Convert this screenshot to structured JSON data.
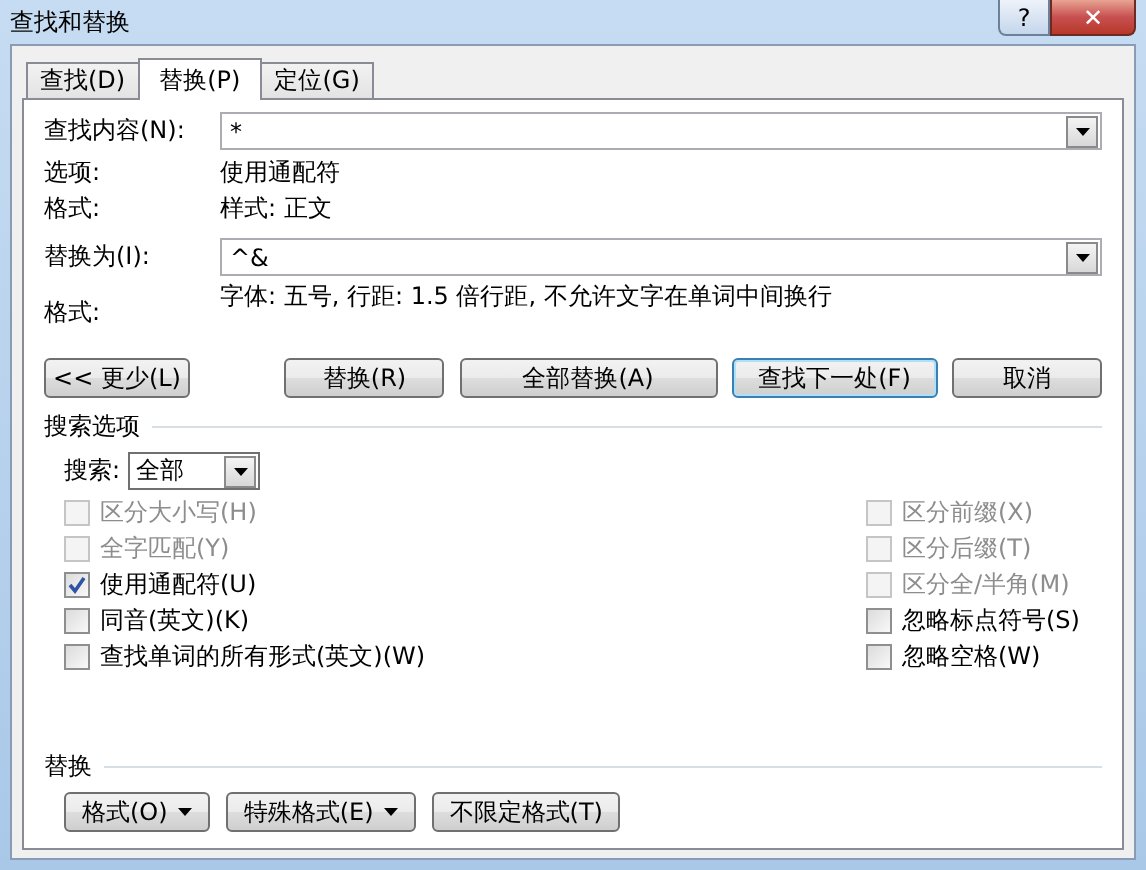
{
  "window": {
    "title": "查找和替换",
    "help_button": "?",
    "close_button": "✕"
  },
  "tabs": [
    {
      "label": "查找(D)",
      "selected": false
    },
    {
      "label": "替换(P)",
      "selected": true
    },
    {
      "label": "定位(G)",
      "selected": false
    }
  ],
  "find": {
    "label": "查找内容(N):",
    "value": "*",
    "options_label": "选项:",
    "options_value": "使用通配符",
    "format_label": "格式:",
    "format_value": "样式: 正文"
  },
  "replace": {
    "label": "替换为(I):",
    "value": "^&",
    "format_label": "格式:",
    "format_value": "字体: 五号, 行距: 1.5 倍行距, 不允许文字在单词中间换行"
  },
  "buttons": [
    {
      "label": "<< 更少(L)",
      "default": false
    },
    {
      "label": "替换(R)",
      "default": false
    },
    {
      "label": "全部替换(A)",
      "default": false
    },
    {
      "label": "查找下一处(F)",
      "default": true
    },
    {
      "label": "取消",
      "default": false
    }
  ],
  "search_options": {
    "title": "搜索选项",
    "search_label": "搜索:",
    "search_value": "全部",
    "left": [
      {
        "label": "区分大小写(H)",
        "checked": false,
        "disabled": true
      },
      {
        "label": "全字匹配(Y)",
        "checked": false,
        "disabled": true
      },
      {
        "label": "使用通配符(U)",
        "checked": true,
        "disabled": false
      },
      {
        "label": "同音(英文)(K)",
        "checked": false,
        "disabled": false
      },
      {
        "label": "查找单词的所有形式(英文)(W)",
        "checked": false,
        "disabled": false
      }
    ],
    "right": [
      {
        "label": "区分前缀(X)",
        "checked": false,
        "disabled": true
      },
      {
        "label": "区分后缀(T)",
        "checked": false,
        "disabled": true
      },
      {
        "label": "区分全/半角(M)",
        "checked": false,
        "disabled": true
      },
      {
        "label": "忽略标点符号(S)",
        "checked": false,
        "disabled": false
      },
      {
        "label": "忽略空格(W)",
        "checked": false,
        "disabled": false
      }
    ]
  },
  "replace_section": {
    "title": "替换",
    "buttons": [
      {
        "label": "格式(O)",
        "menu": true
      },
      {
        "label": "特殊格式(E)",
        "menu": true
      },
      {
        "label": "不限定格式(T)",
        "menu": false
      }
    ]
  }
}
